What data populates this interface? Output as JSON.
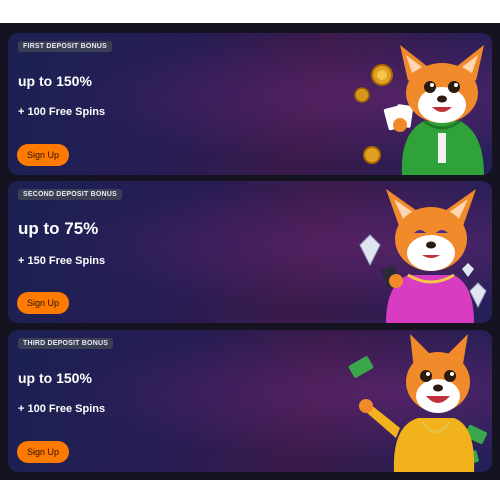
{
  "offers": [
    {
      "badge": "FIRST DEPOSIT BONUS",
      "amount": "up to 150%",
      "spins": "+ 100 Free Spins",
      "cta": "Sign Up"
    },
    {
      "badge": "SECOND DEPOSIT BONUS",
      "amount": "up to 75%",
      "spins": "+ 150 Free Spins",
      "cta": "Sign Up"
    },
    {
      "badge": "THIRD DEPOSIT BONUS",
      "amount": "up to 150%",
      "spins": "+ 100 Free Spins",
      "cta": "Sign Up"
    }
  ],
  "colors": {
    "cta": "#ff7a00",
    "card_bg": "#241d55",
    "badge_bg": "#3b3f55",
    "page_bg": "#15131f"
  },
  "icons": [
    "fox-hoodie-coins-illustration",
    "fox-dress-diamonds-illustration",
    "fox-tshirt-cash-illustration"
  ]
}
